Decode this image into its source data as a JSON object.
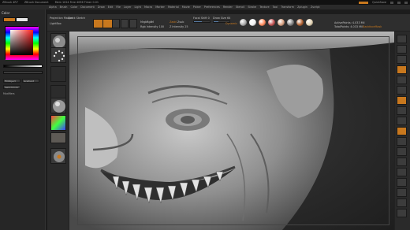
{
  "title_bar": {
    "app": "ZBrush 4R7",
    "document": "ZBrush Document",
    "extra": "Mem 1024 Free 4096 Timer 0.01",
    "quicksave": "QuickSave",
    "window_controls": [
      "minimize-icon",
      "maximize-icon",
      "close-icon"
    ]
  },
  "menu": [
    "Alpha",
    "Brush",
    "Color",
    "Document",
    "Draw",
    "Edit",
    "File",
    "Layer",
    "Light",
    "Macro",
    "Marker",
    "Material",
    "Movie",
    "Picker",
    "Preferences",
    "Render",
    "Stencil",
    "Stroke",
    "Texture",
    "Tool",
    "Transform",
    "Zplugin",
    "Zscript"
  ],
  "left_tray": {
    "header": "Color",
    "main_label": "Main Color",
    "secondary_label": "SecondaryColor",
    "fill_label": "FillObject",
    "switch_label": "SwitchColor",
    "gradient_label": "Gradient",
    "modifiers_label": "Modifiers",
    "main_color": "#c8781e",
    "secondary_color": "#e8e8e8"
  },
  "shelf": {
    "labels": {
      "projection_master": "Projection Master",
      "lightbox": "LightBox",
      "quick_sketch": "Quick Sketch",
      "edit": "Edit",
      "draw": "Draw",
      "move": "Move",
      "scale": "Scale",
      "rotate": "Rotate",
      "mrgb": "Mrgb",
      "rgb": "Rgb",
      "m": "M",
      "zadd": "Zadd",
      "zsub": "Zsub",
      "zcut": "Zcut",
      "focal_shift": "Focal Shift 0",
      "draw_size": "Draw Size 64",
      "dynamic": "Dynamic",
      "rgb_intensity": "Rgb Intensity 100",
      "z_intensity": "Z Intensity 25",
      "active_points": "ActivePoints: 4.033 Mil",
      "total_points": "TotalPoints: 4.033 Mil",
      "backface": "BackfaceMask",
      "matcap": "MatCap Gray"
    },
    "rgb_intensity": 1.0,
    "z_intensity": 0.25,
    "matcaps": [
      "#a9a9a9",
      "#f0f0f0",
      "#ff8a5c",
      "#c05050",
      "#d8a080",
      "#808080",
      "#b06030",
      "#e0d0b0"
    ]
  },
  "left_shelf": {
    "items": [
      "Standard",
      "Dots",
      "Alpha Off",
      "Texture Off",
      "MatCap Gray",
      "Color",
      "Gradient",
      "Material"
    ]
  },
  "right_shelf": {
    "items": [
      "BPR",
      "SPix 3",
      "Scroll",
      "Zoom",
      "Actual",
      "AAHalf",
      "Persp",
      "Floor",
      "Local",
      "L.Sym",
      "Frame",
      "Move",
      "Scale",
      "Rotate",
      "PolyF",
      "Transp",
      "Solo",
      "Xpose"
    ]
  }
}
